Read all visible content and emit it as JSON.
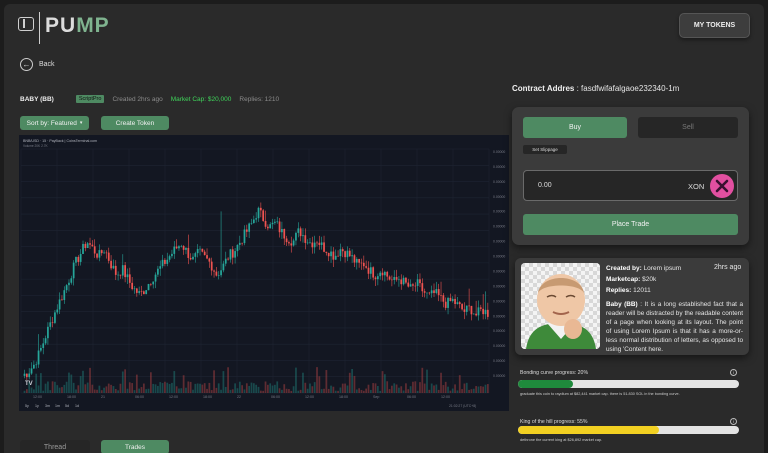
{
  "header": {
    "logo_text_light": "PU",
    "logo_text_green": "MP",
    "my_tokens_label": "MY TOKENS"
  },
  "nav": {
    "back_label": "Back"
  },
  "coin": {
    "name": "BABY (BB)",
    "tag": "ScriptPro",
    "created": "Created 2hrs ago",
    "market_cap": "Market Cap: $20,000",
    "replies": "Replies: 1210"
  },
  "toolbar": {
    "sort_label": "Sort by: Featured",
    "create_label": "Create Token"
  },
  "chart_header": {
    "symbol": "BNB/USD · 15 · PayBack | CoinsTerminal.com",
    "volume": "Volume  20K  2.7K"
  },
  "chart_data": {
    "type": "candlestick",
    "x_labels": [
      "12:00",
      "18:00",
      "21",
      "06:00",
      "12:00",
      "18:00",
      "22",
      "06:00",
      "12:00",
      "18:00",
      "Sep",
      "06:00",
      "12:00"
    ],
    "y_labels": [
      "0.00000",
      "0.00000",
      "0.00000",
      "0.00000",
      "0.00000",
      "0.00000",
      "0.00000",
      "0.00000",
      "0.00000",
      "0.00000",
      "0.00000",
      "0.00000",
      "0.00000",
      "0.00000",
      "0.00000",
      "0.00000"
    ],
    "timeframes": [
      "5y",
      "1y",
      "3m",
      "1m",
      "5d",
      "1d"
    ],
    "timestamp": "21:02:27 (UTC+8)",
    "colors": {
      "up": "#26a69a",
      "down": "#ef5350",
      "background": "#131722",
      "grid": "#1e2432"
    },
    "close_series": [
      0.05,
      0.07,
      0.11,
      0.18,
      0.27,
      0.35,
      0.43,
      0.5,
      0.58,
      0.66,
      0.72,
      0.78,
      0.74,
      0.7,
      0.74,
      0.66,
      0.6,
      0.63,
      0.57,
      0.52,
      0.49,
      0.53,
      0.58,
      0.62,
      0.66,
      0.7,
      0.74,
      0.77,
      0.72,
      0.68,
      0.72,
      0.69,
      0.66,
      0.6,
      0.64,
      0.7,
      0.73,
      0.78,
      0.83,
      0.88,
      0.95,
      0.9,
      0.86,
      0.88,
      0.83,
      0.8,
      0.78,
      0.84,
      0.8,
      0.77,
      0.79,
      0.75,
      0.73,
      0.7,
      0.74,
      0.72,
      0.69,
      0.65,
      0.66,
      0.62,
      0.6,
      0.63,
      0.59,
      0.56,
      0.58,
      0.55,
      0.52,
      0.55,
      0.51,
      0.48,
      0.5,
      0.47,
      0.44,
      0.46,
      0.43,
      0.4,
      0.42,
      0.38,
      0.41,
      0.39
    ]
  },
  "contract": {
    "label": "Contract Addres",
    "value": " : fasdfwifafalgaoe232340-1m"
  },
  "trade": {
    "buy_label": "Buy",
    "sell_label": "Sell",
    "slippage_label": "Set Slippage",
    "amount_value": "0.00",
    "unit": "XON",
    "place_label": "Place Trade"
  },
  "info": {
    "created_label": "Created by:",
    "created_value": " Lorem ipsum",
    "time_ago": "2hrs ago",
    "marketcap_label": "Marketcap:",
    "marketcap_value": " $20k",
    "replies_label": "Replies:",
    "replies_value": " 12011",
    "desc_title": "Baby (BB)",
    "desc_body": " : It is a long established fact that a reader will be distracted by the readable content of a page when looking at its layout. The point of using Lorem Ipsum is that it has a more-or-less normal distribution of letters, as opposed to using 'Content here."
  },
  "bonding": {
    "label": "Bonding curve progress: 20%",
    "progress": 0.25,
    "color": "#1f8a3c",
    "note": "graduate this coin to raydium at $82,441 market cap. there is 51.830 SOL in the bonding curve."
  },
  "king": {
    "label": "King of the hill progress: 55%",
    "progress": 0.64,
    "color": "#f2d022",
    "note": "dethrone the current king at $26,892 market cap."
  },
  "tabs": {
    "thread_label": "Thread",
    "trades_label": "Trades"
  }
}
